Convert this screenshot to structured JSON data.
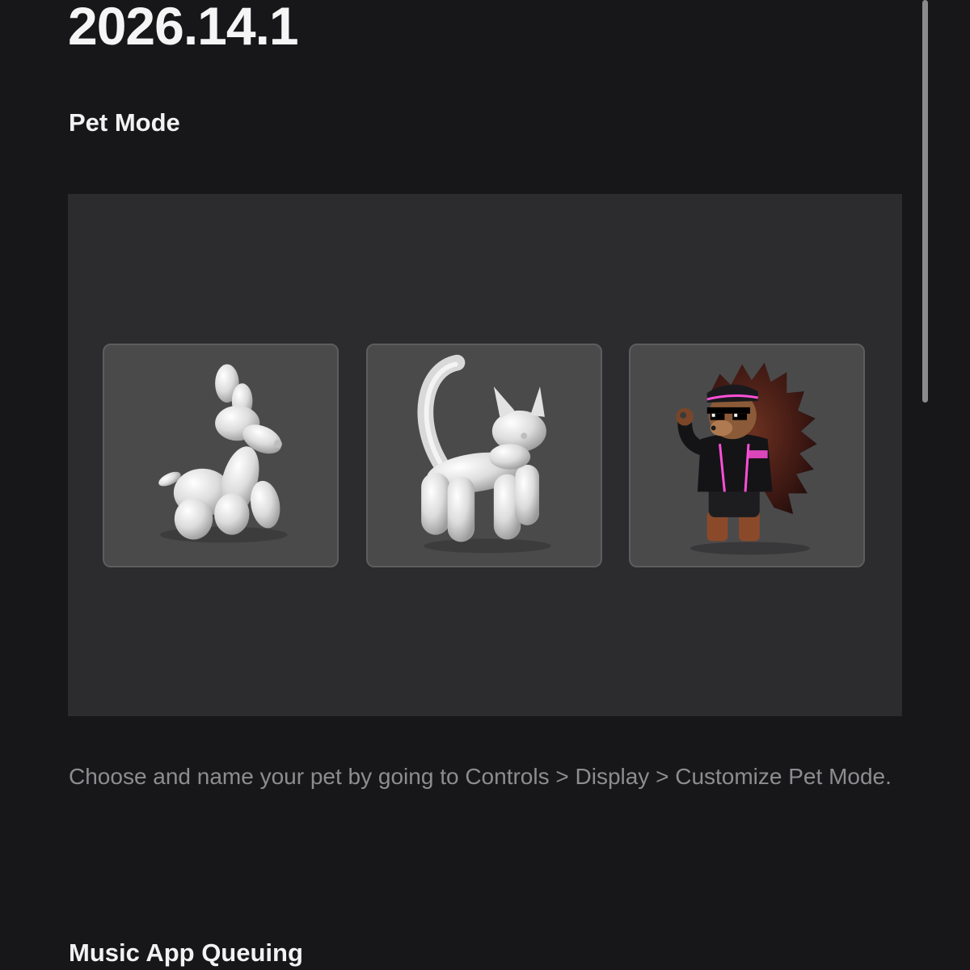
{
  "release": {
    "version": "2026.14.1"
  },
  "features": [
    {
      "heading": "Pet Mode",
      "description": "Choose and name your pet by going to Controls > Display > Customize Pet Mode.",
      "pets": [
        {
          "icon": "balloon-dog-icon"
        },
        {
          "icon": "balloon-cat-icon"
        },
        {
          "icon": "hedgehog-character-icon"
        }
      ]
    },
    {
      "heading": "Music App Queuing"
    }
  ],
  "colors": {
    "background": "#17171a",
    "panel": "#2c2c2e",
    "card": "#4a4a4b",
    "muted_text": "#8d8d90",
    "accent_pink": "#ff4fd8"
  }
}
